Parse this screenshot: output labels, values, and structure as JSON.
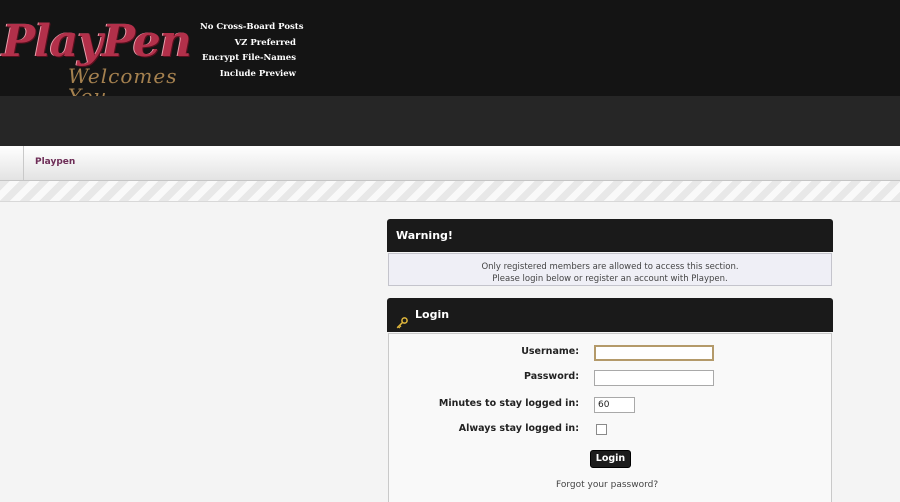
{
  "header": {
    "logo_text": "PlayPen",
    "logo_subtext": "Welcomes You",
    "taglines": [
      "No Cross-Board Posts",
      "VZ Preferred",
      "Encrypt File-Names",
      "Include Preview"
    ]
  },
  "breadcrumb": {
    "current": "Playpen"
  },
  "warning": {
    "title": "Warning!",
    "line1": "Only registered members are allowed to access this section.",
    "line2": "Please login below or register an account with Playpen."
  },
  "login": {
    "title": "Login",
    "username_label": "Username:",
    "username_value": "",
    "password_label": "Password:",
    "password_value": "",
    "minutes_label": "Minutes to stay logged in:",
    "minutes_value": "60",
    "always_label": "Always stay logged in:",
    "always_checked": false,
    "button_label": "Login",
    "forgot_link": "Forgot your password?"
  }
}
